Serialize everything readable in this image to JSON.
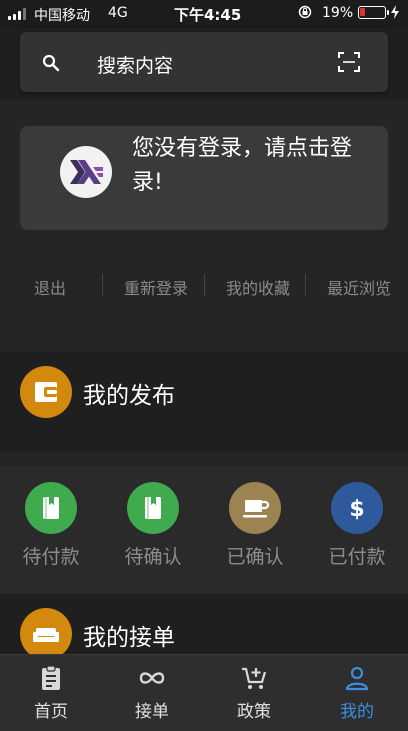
{
  "status_bar": {
    "carrier": "中国移动",
    "network": "4G",
    "time": "下午4:45",
    "battery_percent": "19%",
    "battery_level": 0.19
  },
  "search": {
    "placeholder": "搜索内容",
    "search_icon": "search-icon",
    "scan_icon": "scan-icon"
  },
  "login": {
    "prompt": "您没有登录，请点击登录!",
    "avatar_icon": "haskell-logo-icon"
  },
  "quick_actions": [
    {
      "label": "退出"
    },
    {
      "label": "重新登录"
    },
    {
      "label": "我的收藏"
    },
    {
      "label": "最近浏览"
    }
  ],
  "my_publish": {
    "title": "我的发布",
    "icon": "wallet-icon",
    "icon_color": "#d2890d"
  },
  "order_status": [
    {
      "label": "待付款",
      "icon": "book-icon",
      "color": "#3faa4e"
    },
    {
      "label": "待确认",
      "icon": "book-icon",
      "color": "#3faa4e"
    },
    {
      "label": "已确认",
      "icon": "coffee-cup-icon",
      "color": "#9c8452"
    },
    {
      "label": "已付款",
      "icon": "dollar-icon",
      "color": "#2e5a9c"
    }
  ],
  "my_orders": {
    "title": "我的接单",
    "icon": "sofa-icon",
    "icon_color": "#d2890d"
  },
  "nav": [
    {
      "label": "首页",
      "icon": "clipboard-icon",
      "active": false
    },
    {
      "label": "接单",
      "icon": "infinity-icon",
      "active": false
    },
    {
      "label": "政策",
      "icon": "cart-add-icon",
      "active": false
    },
    {
      "label": "我的",
      "icon": "person-icon",
      "active": true
    }
  ],
  "colors": {
    "accent": "#3b8fe0",
    "background": "#252525"
  }
}
